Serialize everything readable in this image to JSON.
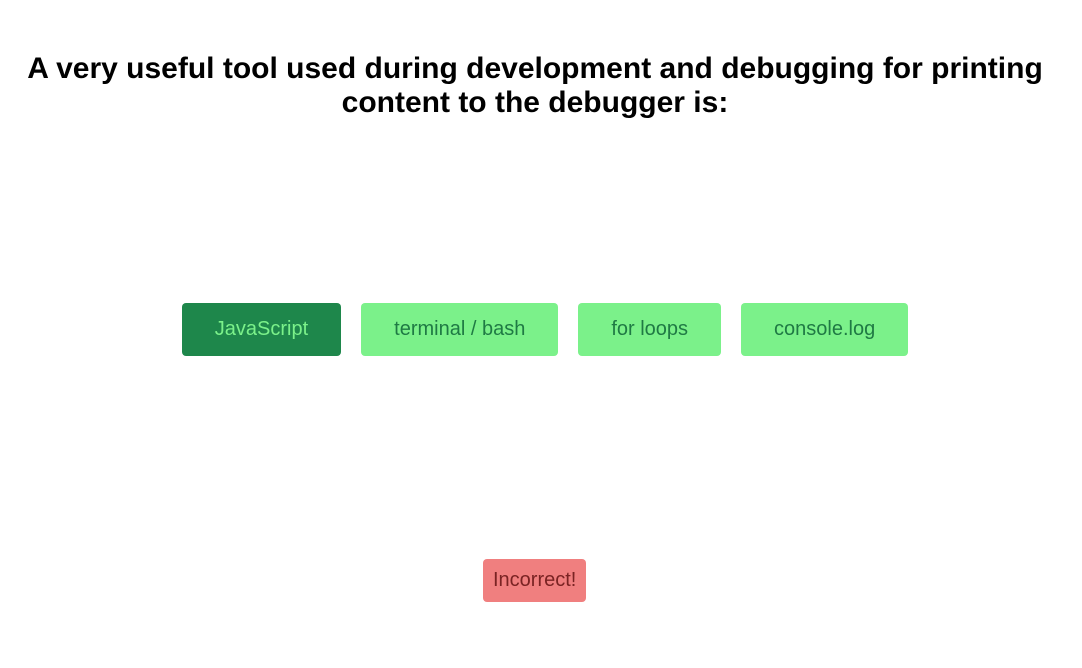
{
  "question": {
    "text": "A very useful tool used during development and debugging for printing content to the debugger is:"
  },
  "answers": [
    {
      "label": "JavaScript",
      "selected": true
    },
    {
      "label": "terminal / bash",
      "selected": false
    },
    {
      "label": "for loops",
      "selected": false
    },
    {
      "label": "console.log",
      "selected": false
    }
  ],
  "feedback": {
    "text": "Incorrect!",
    "status": "incorrect",
    "color": "#f07f7f"
  },
  "colors": {
    "answer_bg": "#7bf18a",
    "answer_text": "#1f7a44",
    "selected_bg": "#1e874b",
    "selected_text": "#7bf18a"
  }
}
